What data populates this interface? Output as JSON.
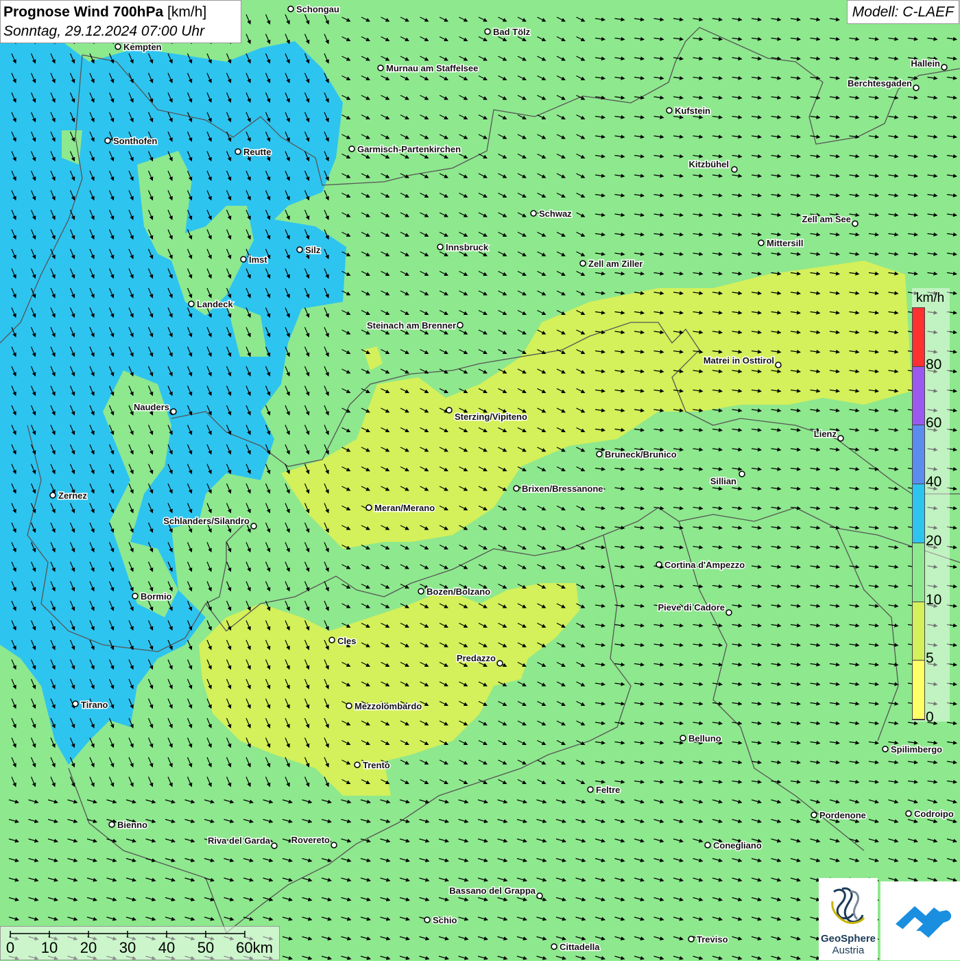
{
  "header": {
    "title_bold": "Prognose Wind 700hPa",
    "title_unit": " [km/h]",
    "subtitle": "Sonntag, 29.12.2024 07:00 Uhr",
    "model": "Modell: C-LAEF"
  },
  "legend": {
    "unit": "km/h",
    "ticks": [
      "80",
      "60",
      "40",
      "20",
      "10",
      "5",
      "0"
    ],
    "colors": [
      "#ff3030",
      "#9b59f0",
      "#5b8def",
      "#2ec4f0",
      "#8ee88e",
      "#d4f05a",
      "#ffff66"
    ]
  },
  "scale_bar": {
    "labels": [
      "0",
      "10",
      "20",
      "30",
      "40",
      "50",
      "60km"
    ]
  },
  "logos": {
    "geosphere_line1": "GeoSphere",
    "geosphere_line2": "Austria"
  },
  "colors": {
    "wind_0_5": "#ffff66",
    "wind_5_10": "#d4f05a",
    "wind_10_20": "#8ee88e",
    "wind_20_40": "#2ec4f0",
    "border": "#555555",
    "arrow": "#000000"
  },
  "cities": [
    {
      "name": "Schongau"
    },
    {
      "name": "Bad Tölz"
    },
    {
      "name": "Kempten"
    },
    {
      "name": "Murnau am Staffelsee"
    },
    {
      "name": "Hallein"
    },
    {
      "name": "Berchtesgaden"
    },
    {
      "name": "Kufstein"
    },
    {
      "name": "Sonthofen"
    },
    {
      "name": "Reutte"
    },
    {
      "name": "Garmisch-Partenkirchen"
    },
    {
      "name": "Kitzbühel"
    },
    {
      "name": "Schwaz"
    },
    {
      "name": "Zell am See"
    },
    {
      "name": "Innsbruck"
    },
    {
      "name": "Mittersill"
    },
    {
      "name": "Imst"
    },
    {
      "name": "Silz"
    },
    {
      "name": "Zell am Ziller"
    },
    {
      "name": "Landeck"
    },
    {
      "name": "Steinach am Brenner"
    },
    {
      "name": "Matrei in Osttirol"
    },
    {
      "name": "Nauders"
    },
    {
      "name": "Sterzing/Vipiteno"
    },
    {
      "name": "Lienz"
    },
    {
      "name": "Bruneck/Brunico"
    },
    {
      "name": "Sillian"
    },
    {
      "name": "Brixen/Bressanone"
    },
    {
      "name": "Zernez"
    },
    {
      "name": "Meran/Merano"
    },
    {
      "name": "Schlanders/Silandro"
    },
    {
      "name": "Cortina d'Ampezzo"
    },
    {
      "name": "Bozen/Bolzano"
    },
    {
      "name": "Bormio"
    },
    {
      "name": "Pieve di Cadore"
    },
    {
      "name": "Cles"
    },
    {
      "name": "Predazzo"
    },
    {
      "name": "Tirano"
    },
    {
      "name": "Mezzolombardo"
    },
    {
      "name": "Belluno"
    },
    {
      "name": "Spilimbergo"
    },
    {
      "name": "Trento"
    },
    {
      "name": "Feltre"
    },
    {
      "name": "Pordenone"
    },
    {
      "name": "Codroipo"
    },
    {
      "name": "Bienno"
    },
    {
      "name": "Riva del Garda"
    },
    {
      "name": "Rovereto"
    },
    {
      "name": "Conegliano"
    },
    {
      "name": "Bassano del Grappa"
    },
    {
      "name": "Schio"
    },
    {
      "name": "Treviso"
    },
    {
      "name": "Cittadella"
    }
  ]
}
